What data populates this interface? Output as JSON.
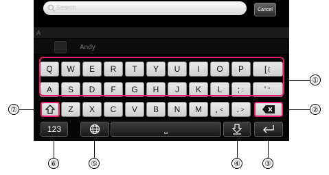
{
  "search": {
    "placeholder": "Search",
    "cancel_label": "Cancel"
  },
  "contacts": {
    "section_letter": "A",
    "items": [
      {
        "name": "Andy"
      }
    ]
  },
  "keyboard": {
    "row1": [
      "Q",
      "W",
      "E",
      "R",
      "T",
      "Y",
      "U",
      "I",
      "O",
      "P"
    ],
    "row1_bracket": [
      "[",
      "{"
    ],
    "row2": [
      "A",
      "S",
      "D",
      "F",
      "G",
      "H",
      "J",
      "K",
      "L"
    ],
    "row2_semicolon": [
      ";",
      ":"
    ],
    "row2_quote": [
      "'",
      "\""
    ],
    "row3": [
      "Z",
      "X",
      "C",
      "V",
      "B",
      "N",
      "M"
    ],
    "row3_comma": [
      ",",
      "<"
    ],
    "row3_period": [
      ".",
      ">"
    ],
    "numbers_label": "123",
    "space_symbol": "⎵"
  },
  "callouts": [
    "①",
    "②",
    "③",
    "④",
    "⑤",
    "⑥",
    "⑦"
  ],
  "colors": {
    "highlight": "#ea1b6e",
    "screen": "#000000",
    "key": "#e0e0e0"
  }
}
